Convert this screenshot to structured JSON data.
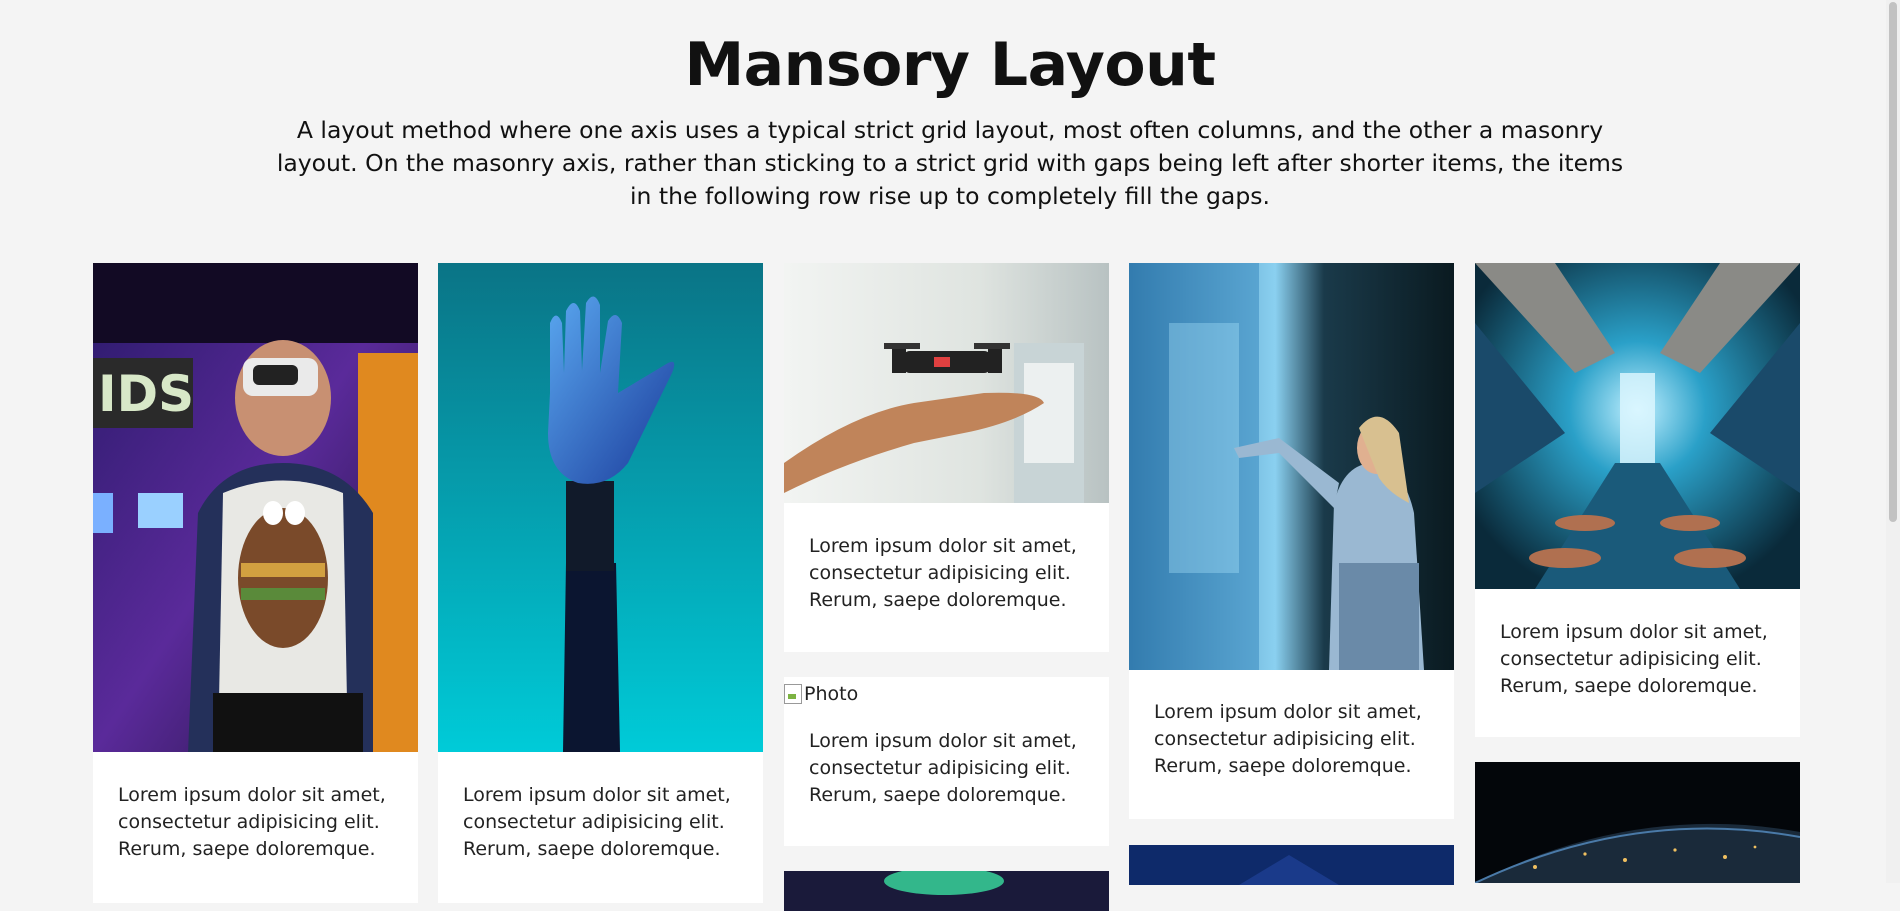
{
  "page": {
    "title": "Mansory Layout",
    "subtitle": "A layout method where one axis uses a typical strict grid layout, most often columns, and the other a masonry layout. On the masonry axis, rather than sticking to a strict grid with gaps being left after shorter items, the items in the following row rise up to completely fill the gaps."
  },
  "cards": {
    "caption_line1": "Lorem ipsum dolor sit amet,",
    "caption_line2": "consectetur adipisicing elit.",
    "caption_line3": "Rerum, saepe doloremque.",
    "broken_alt": "Photo"
  },
  "images": [
    {
      "name": "vr-headset-photo"
    },
    {
      "name": "robotic-hand-photo"
    },
    {
      "name": "drone-on-hand-photo"
    },
    {
      "name": "woman-touching-screen-photo"
    },
    {
      "name": "space-station-interior-photo"
    },
    {
      "name": "earth-at-night-photo"
    }
  ]
}
